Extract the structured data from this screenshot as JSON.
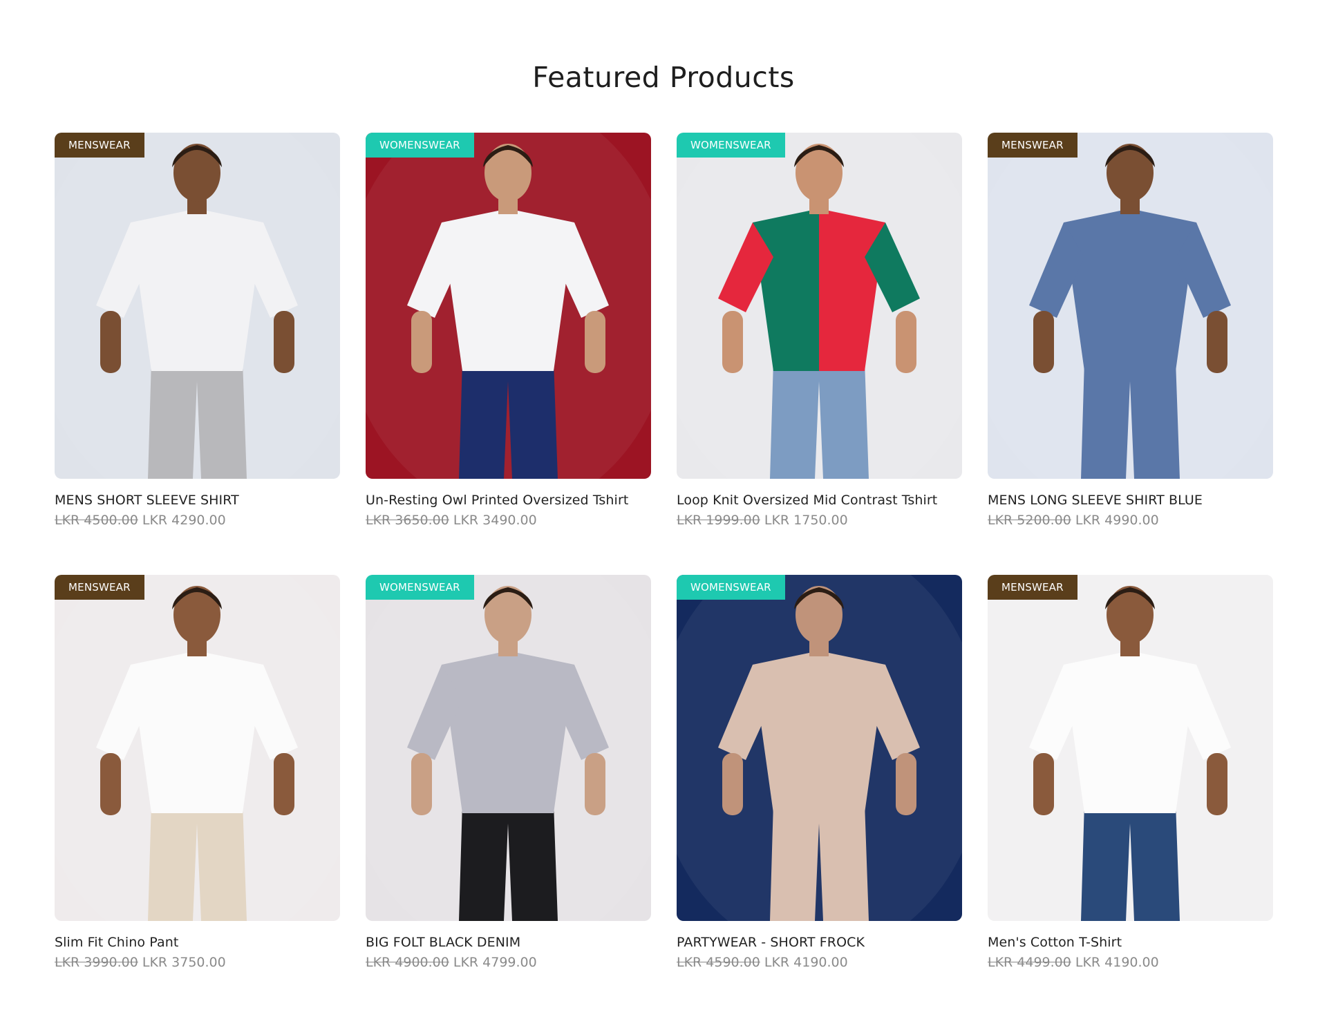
{
  "section": {
    "title": "Featured Products"
  },
  "products": [
    {
      "badge": "MENSWEAR",
      "badge_type": "men",
      "name": "MENS SHORT SLEEVE SHIRT",
      "old_price": "LKR 4500.00",
      "price": "LKR 4290.00",
      "bg": "#dfe3ea",
      "garment": "#f2f2f4",
      "lower": "#b8b8bb",
      "skin": "#7a4f33"
    },
    {
      "badge": "WOMENSWEAR",
      "badge_type": "women",
      "name": "Un-Resting Owl Printed Oversized Tshirt",
      "old_price": "LKR 3650.00",
      "price": "LKR 3490.00",
      "bg": "#9c1423",
      "garment": "#f4f4f6",
      "lower": "#1d2e6b",
      "skin": "#c99a7a"
    },
    {
      "badge": "WOMENSWEAR",
      "badge_type": "women",
      "name": "Loop Knit Oversized Mid Contrast Tshirt",
      "old_price": "LKR 1999.00",
      "price": "LKR 1750.00",
      "bg": "#e9e9ec",
      "garment": "#0f7a5f",
      "garment2": "#e5273d",
      "lower": "#7d9cc2",
      "skin": "#c99372"
    },
    {
      "badge": "MENSWEAR",
      "badge_type": "men",
      "name": "MENS LONG SLEEVE SHIRT BLUE",
      "old_price": "LKR 5200.00",
      "price": "LKR 4990.00",
      "bg": "#dfe4ee",
      "garment": "#5a77a8",
      "lower": "#5a77a8",
      "skin": "#7a4f33"
    },
    {
      "badge": "MENSWEAR",
      "badge_type": "men",
      "name": "Slim Fit Chino Pant",
      "old_price": "LKR 3990.00",
      "price": "LKR 3750.00",
      "bg": "#efebec",
      "garment": "#fbfbfb",
      "lower": "#e3d6c4",
      "skin": "#8a5a3c"
    },
    {
      "badge": "WOMENSWEAR",
      "badge_type": "women",
      "name": "BIG FOLT BLACK DENIM",
      "old_price": "LKR 4900.00",
      "price": "LKR 4799.00",
      "bg": "#e6e3e6",
      "garment": "#b9b9c4",
      "lower": "#1c1c1f",
      "skin": "#c9a085"
    },
    {
      "badge": "WOMENSWEAR",
      "badge_type": "women",
      "name": "PARTYWEAR - SHORT FROCK",
      "old_price": "LKR 4590.00",
      "price": "LKR 4190.00",
      "bg": "#142a5e",
      "garment": "#d9bfb0",
      "lower": "#d9bfb0",
      "skin": "#c0937a"
    },
    {
      "badge": "MENSWEAR",
      "badge_type": "men",
      "name": "Men's Cotton T-Shirt",
      "old_price": "LKR 4499.00",
      "price": "LKR 4190.00",
      "bg": "#f2f1f2",
      "garment": "#fcfcfc",
      "lower": "#2a4a7a",
      "skin": "#8a5a3c"
    }
  ]
}
